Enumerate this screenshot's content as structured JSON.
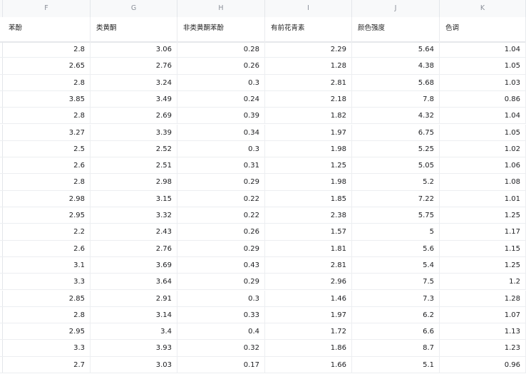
{
  "columns": [
    {
      "letter": "F",
      "header": "苯酚"
    },
    {
      "letter": "G",
      "header": "类黄酮"
    },
    {
      "letter": "H",
      "header": "非类黄酮苯酚"
    },
    {
      "letter": "I",
      "header": "有前花青素"
    },
    {
      "letter": "J",
      "header": "颜色强度"
    },
    {
      "letter": "K",
      "header": "色调"
    }
  ],
  "rows": [
    [
      "2.8",
      "3.06",
      "0.28",
      "2.29",
      "5.64",
      "1.04"
    ],
    [
      "2.65",
      "2.76",
      "0.26",
      "1.28",
      "4.38",
      "1.05"
    ],
    [
      "2.8",
      "3.24",
      "0.3",
      "2.81",
      "5.68",
      "1.03"
    ],
    [
      "3.85",
      "3.49",
      "0.24",
      "2.18",
      "7.8",
      "0.86"
    ],
    [
      "2.8",
      "2.69",
      "0.39",
      "1.82",
      "4.32",
      "1.04"
    ],
    [
      "3.27",
      "3.39",
      "0.34",
      "1.97",
      "6.75",
      "1.05"
    ],
    [
      "2.5",
      "2.52",
      "0.3",
      "1.98",
      "5.25",
      "1.02"
    ],
    [
      "2.6",
      "2.51",
      "0.31",
      "1.25",
      "5.05",
      "1.06"
    ],
    [
      "2.8",
      "2.98",
      "0.29",
      "1.98",
      "5.2",
      "1.08"
    ],
    [
      "2.98",
      "3.15",
      "0.22",
      "1.85",
      "7.22",
      "1.01"
    ],
    [
      "2.95",
      "3.32",
      "0.22",
      "2.38",
      "5.75",
      "1.25"
    ],
    [
      "2.2",
      "2.43",
      "0.26",
      "1.57",
      "5",
      "1.17"
    ],
    [
      "2.6",
      "2.76",
      "0.29",
      "1.81",
      "5.6",
      "1.15"
    ],
    [
      "3.1",
      "3.69",
      "0.43",
      "2.81",
      "5.4",
      "1.25"
    ],
    [
      "3.3",
      "3.64",
      "0.29",
      "2.96",
      "7.5",
      "1.2"
    ],
    [
      "2.85",
      "2.91",
      "0.3",
      "1.46",
      "7.3",
      "1.28"
    ],
    [
      "2.8",
      "3.14",
      "0.33",
      "1.97",
      "6.2",
      "1.07"
    ],
    [
      "2.95",
      "3.4",
      "0.4",
      "1.72",
      "6.6",
      "1.13"
    ],
    [
      "3.3",
      "3.93",
      "0.32",
      "1.86",
      "8.7",
      "1.23"
    ],
    [
      "2.7",
      "3.03",
      "0.17",
      "1.66",
      "5.1",
      "0.96"
    ]
  ]
}
